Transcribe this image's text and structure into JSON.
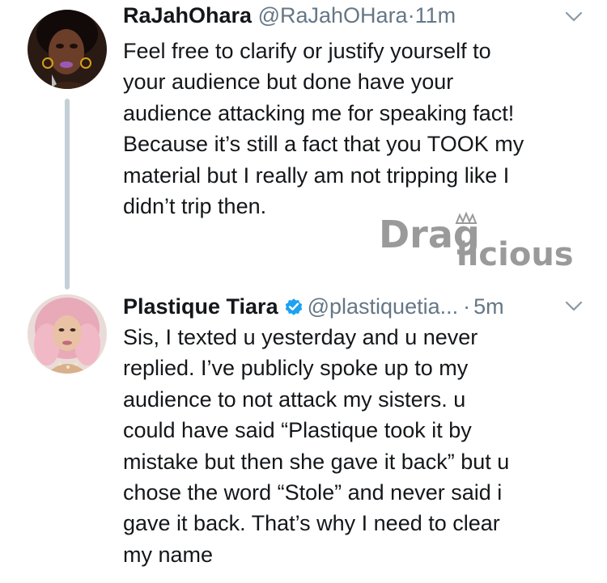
{
  "tweets": [
    {
      "name": "RaJahOhara",
      "handle": "@RaJahOHara",
      "separator": "·",
      "time": "11m",
      "lines": [
        "Feel free to clarify or justify yourself to",
        "your audience but done have your",
        "audience attacking me for speaking fact!",
        "Because it’s still a fact that you TOOK my",
        "material but I really am not tripping like I",
        "didn’t trip then."
      ],
      "avatar_icon": "avatar-rajah"
    },
    {
      "name": "Plastique Tiara",
      "verified": true,
      "handle": "@plastiquetia...",
      "separator": "·",
      "time": "5m",
      "lines": [
        "Sis, I texted u yesterday and u never",
        "replied. I’ve publicly spoke up to my",
        "audience to not attack my sisters. u",
        "could have said “Plastique took it by",
        "mistake but then she gave it back” but u",
        "chose the word “Stole” and never said i",
        "gave it back. That’s why I need to clear",
        "my name"
      ],
      "avatar_icon": "avatar-plastique"
    }
  ],
  "watermark": {
    "text": "Draglicious",
    "color": "#9a9a9a"
  },
  "colors": {
    "text": "#14171a",
    "secondary": "#657786",
    "thread_line": "#c4cfd6",
    "verified": "#1da1f2"
  }
}
